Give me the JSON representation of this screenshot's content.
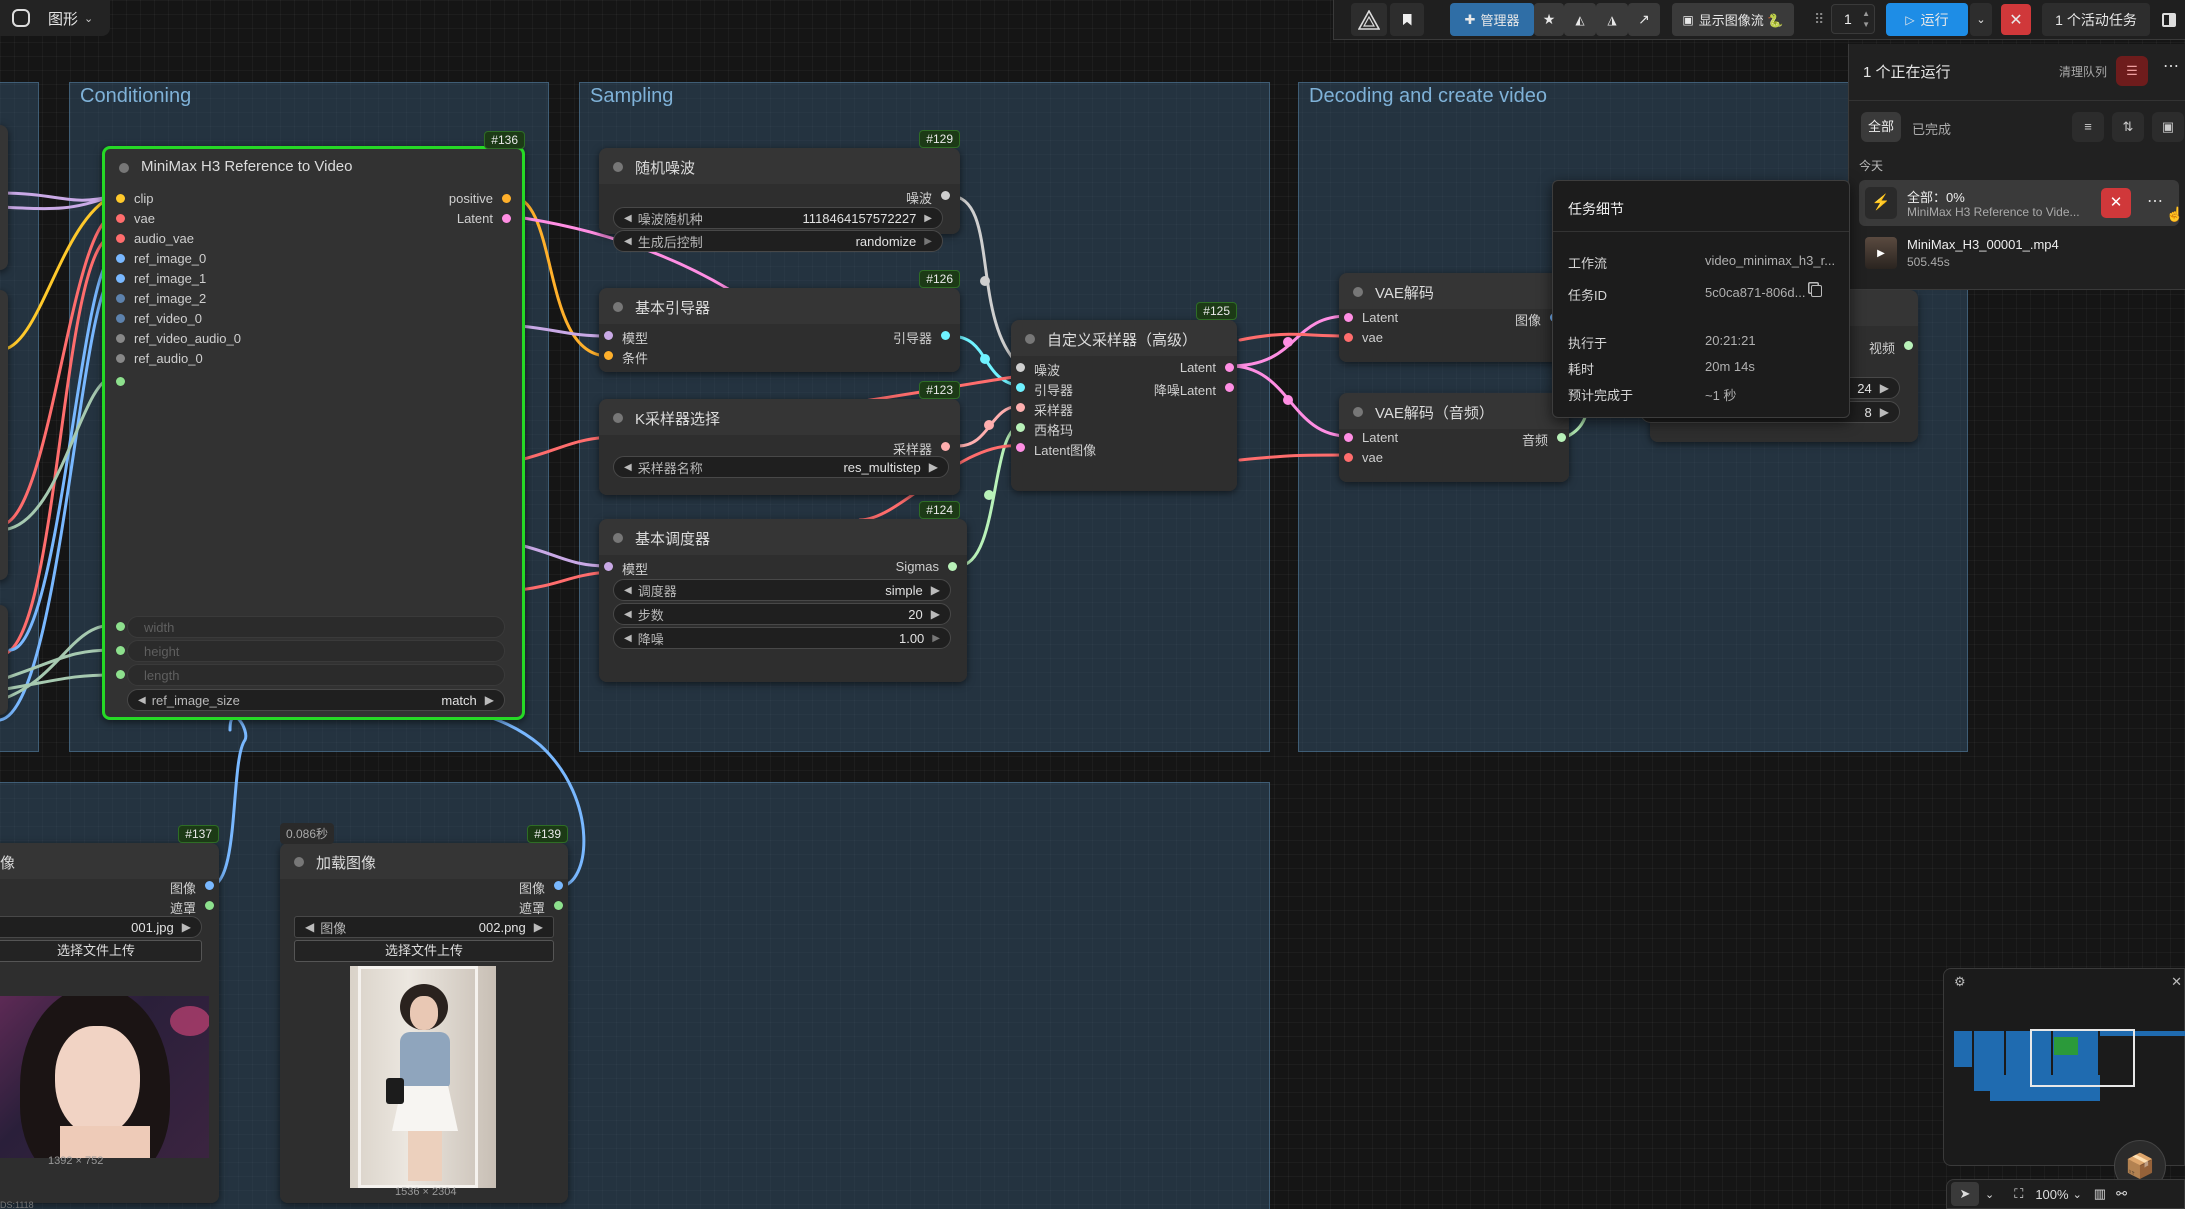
{
  "topbar": {
    "workspace_label": "图形",
    "manager_label": "管理器",
    "show_image_flow_label": "显示图像流 🐍",
    "batch_count": "1",
    "run_label": "运行",
    "active_tasks_label": "1 个活动任务"
  },
  "groups": {
    "conditioning": "Conditioning",
    "sampling": "Sampling",
    "decoding": "Decoding and create video"
  },
  "nodes": {
    "n136": {
      "id": "#136",
      "title": "MiniMax H3 Reference to Video",
      "inputs": [
        "clip",
        "vae",
        "audio_vae",
        "ref_image_0",
        "ref_image_1",
        "ref_image_2",
        "ref_video_0",
        "ref_video_audio_0",
        "ref_audio_0"
      ],
      "outputs": [
        "positive",
        "Latent"
      ],
      "disabled_widgets": [
        "width",
        "height",
        "length"
      ],
      "ref_size_label": "ref_image_size",
      "ref_size_value": "match"
    },
    "n129": {
      "id": "#129",
      "title": "随机噪波",
      "output": "噪波",
      "seed_label": "噪波随机种",
      "seed_value": "1118464157572227",
      "ctrl_label": "生成后控制",
      "ctrl_value": "randomize"
    },
    "n126": {
      "id": "#126",
      "title": "基本引导器",
      "in_model": "模型",
      "in_cond": "条件",
      "output": "引导器"
    },
    "n123": {
      "id": "#123",
      "title": "K采样器选择",
      "output": "采样器",
      "name_label": "采样器名称",
      "name_value": "res_multistep"
    },
    "n124": {
      "id": "#124",
      "title": "基本调度器",
      "in_model": "模型",
      "output": "Sigmas",
      "sched_label": "调度器",
      "sched_value": "simple",
      "steps_label": "步数",
      "steps_value": "20",
      "denoise_label": "降噪",
      "denoise_value": "1.00"
    },
    "n125": {
      "id": "#125",
      "title": "自定义采样器（高级）",
      "inputs": [
        "噪波",
        "引导器",
        "采样器",
        "西格玛",
        "Latent图像"
      ],
      "out1": "Latent",
      "out2": "降噪Latent"
    },
    "vae1": {
      "id": "#12",
      "title": "VAE解码",
      "in1": "Latent",
      "in2": "vae",
      "output": "图像"
    },
    "vae2": {
      "id": "#12",
      "title": "VAE解码（音频）",
      "in1": "Latent",
      "in2": "vae",
      "output": "音频"
    },
    "video": {
      "output": "视频",
      "v1": "24",
      "v2": "8"
    },
    "n137": {
      "id": "#137",
      "title": "像",
      "out1": "图像",
      "out2": "遮罩",
      "file": "001.jpg",
      "upload": "选择文件上传",
      "dims": "1392 × 752"
    },
    "n139": {
      "id": "#139",
      "title": "加载图像",
      "timer": "0.086秒",
      "out1": "图像",
      "out2": "遮罩",
      "img_label": "图像",
      "file": "002.png",
      "upload": "选择文件上传",
      "dims": "1536 × 2304"
    }
  },
  "queue": {
    "running_title": "1 个正在运行",
    "clear_label": "清理队列",
    "tab_all": "全部",
    "tab_done": "已完成",
    "today": "今天",
    "job1_title": "全部：0%",
    "job1_sub": "MiniMax H3 Reference to Vide...",
    "job2_title": "MiniMax_H3_00001_.mp4",
    "job2_sub": "505.45s"
  },
  "details": {
    "title": "任务细节",
    "workflow_k": "工作流",
    "workflow_v": "video_minimax_h3_r...",
    "taskid_k": "任务ID",
    "taskid_v": "5c0ca871-806d...",
    "exec_k": "执行于",
    "exec_v": "20:21:21",
    "elapsed_k": "耗时",
    "elapsed_v": "20m 14s",
    "eta_k": "预计完成于",
    "eta_v": "~1 秒"
  },
  "bottombar": {
    "zoom": "100%"
  },
  "footer_text": "DS:1118"
}
